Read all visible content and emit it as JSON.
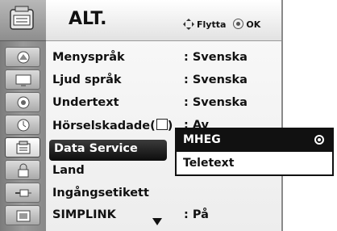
{
  "menu": {
    "title": "ALT.",
    "hint_move": "Flytta",
    "hint_ok": "OK"
  },
  "sidebar": {
    "items": [
      {
        "icon": "picture-icon"
      },
      {
        "icon": "screen-icon"
      },
      {
        "icon": "audio-icon"
      },
      {
        "icon": "clock-icon"
      },
      {
        "icon": "option-icon",
        "active": true
      },
      {
        "icon": "lock-icon"
      },
      {
        "icon": "input-icon"
      },
      {
        "icon": "usb-icon"
      }
    ]
  },
  "settings": {
    "rows": [
      {
        "label": "Menyspråk",
        "value": ": Svenska"
      },
      {
        "label": "Ljud språk",
        "value": ": Svenska"
      },
      {
        "label": "Undertext",
        "value": ": Svenska"
      },
      {
        "label": "Hörselskadade(",
        "label_suffix": ")",
        "value": ": Av"
      },
      {
        "label": "Data Service",
        "value": ""
      },
      {
        "label": "Land",
        "value": ""
      },
      {
        "label": "Ingångsetikett",
        "value": ""
      },
      {
        "label": "SIMPLINK",
        "value": ": På"
      }
    ]
  },
  "popup": {
    "options": [
      {
        "label": "MHEG",
        "selected": true
      },
      {
        "label": "Teletext",
        "selected": false
      }
    ]
  },
  "colors": {
    "selected_bg": "#111111",
    "panel_bg": "#f4f4f4",
    "sidebar_bg": "#8a8a8a"
  }
}
